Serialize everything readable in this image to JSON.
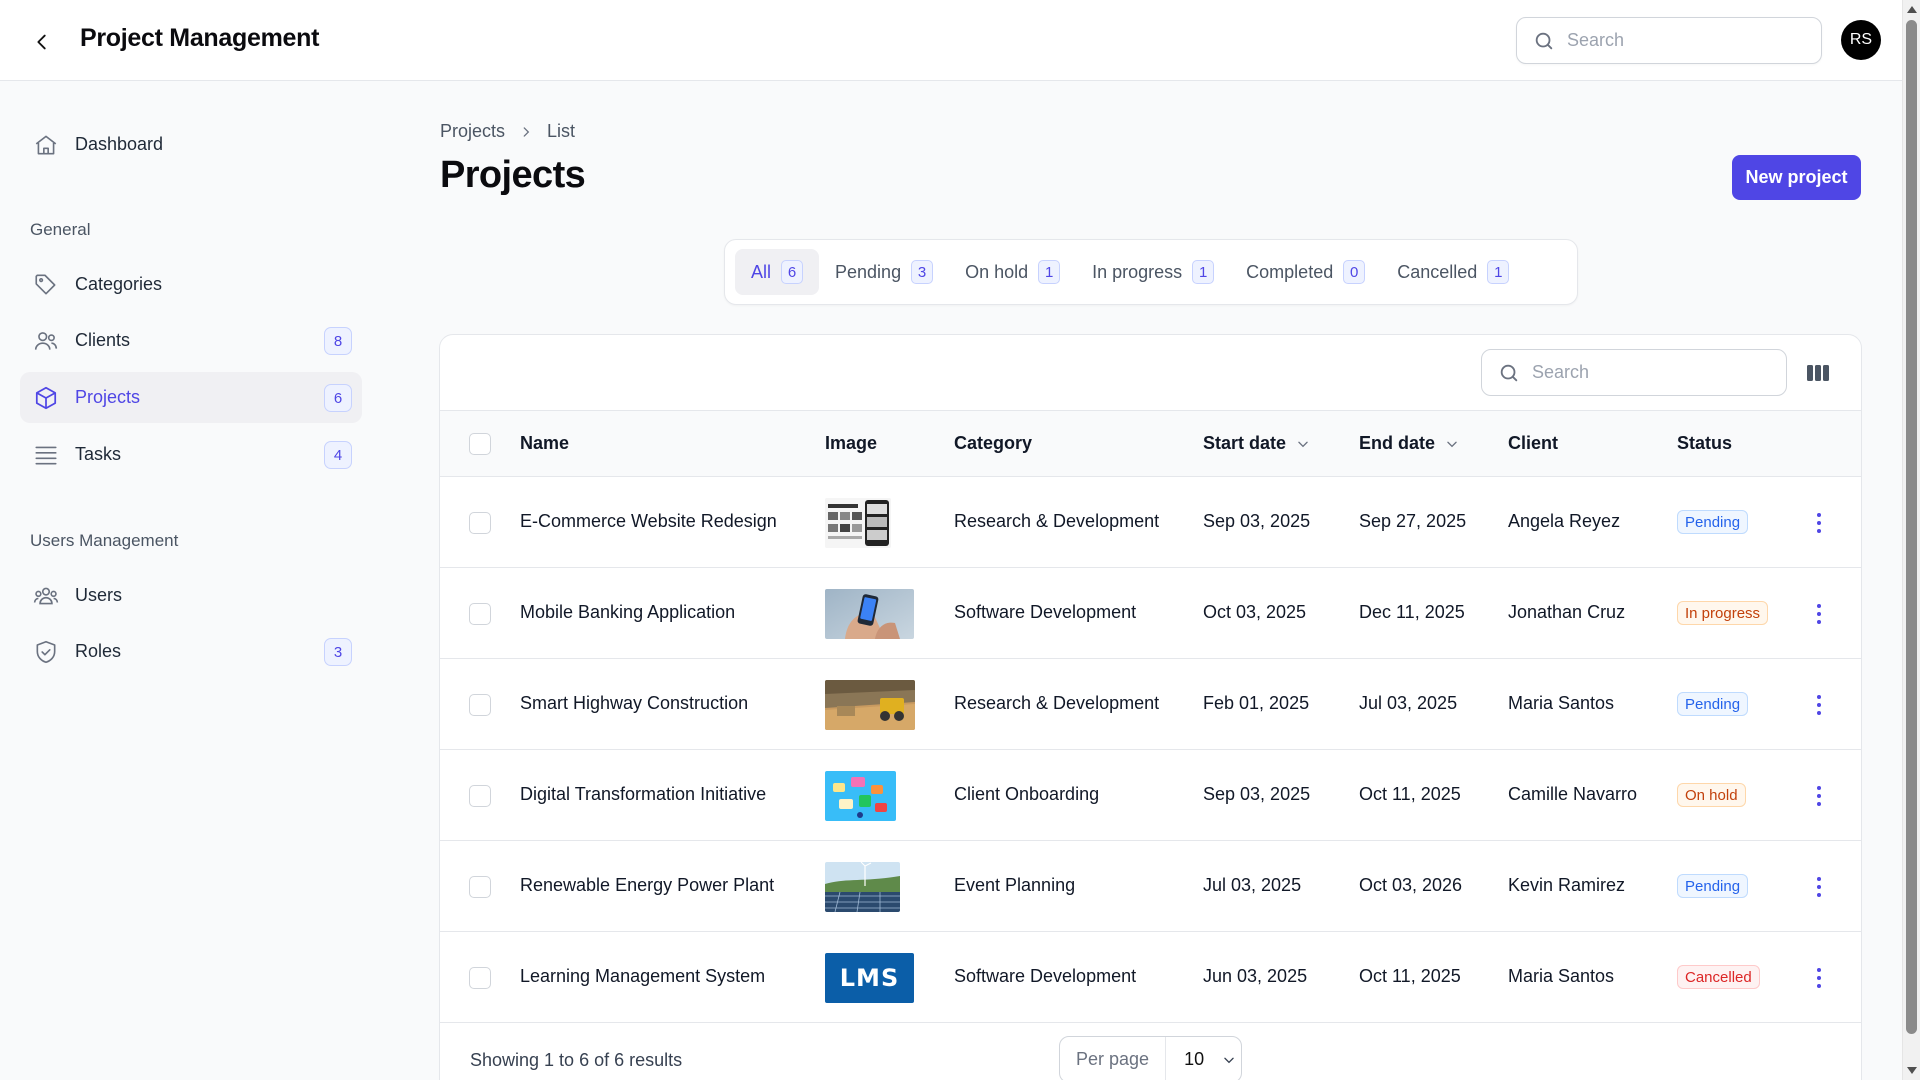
{
  "header": {
    "title": "Project Management",
    "search_placeholder": "Search",
    "avatar_initials": "RS"
  },
  "sidebar": {
    "dashboard": "Dashboard",
    "general_heading": "General",
    "categories": "Categories",
    "clients": {
      "label": "Clients",
      "count": "8"
    },
    "projects": {
      "label": "Projects",
      "count": "6"
    },
    "tasks": {
      "label": "Tasks",
      "count": "4"
    },
    "users_heading": "Users Management",
    "users": "Users",
    "roles": {
      "label": "Roles",
      "count": "3"
    }
  },
  "breadcrumb": [
    "Projects",
    "List"
  ],
  "page_title": "Projects",
  "new_button": "New project",
  "tabs": [
    {
      "label": "All",
      "count": "6"
    },
    {
      "label": "Pending",
      "count": "3"
    },
    {
      "label": "On hold",
      "count": "1"
    },
    {
      "label": "In progress",
      "count": "1"
    },
    {
      "label": "Completed",
      "count": "0"
    },
    {
      "label": "Cancelled",
      "count": "1"
    }
  ],
  "table": {
    "search_placeholder": "Search",
    "columns": {
      "name": "Name",
      "image": "Image",
      "category": "Category",
      "start": "Start date",
      "end": "End date",
      "client": "Client",
      "status": "Status"
    },
    "rows": [
      {
        "name": "E-Commerce Website Redesign",
        "image": "ecommerce-mockup",
        "category": "Research & Development",
        "start": "Sep 03, 2025",
        "end": "Sep 27, 2025",
        "client": "Angela Reyez",
        "status": "Pending",
        "status_key": "pending"
      },
      {
        "name": "Mobile Banking Application",
        "image": "phone-in-hand",
        "category": "Software Development",
        "start": "Oct 03, 2025",
        "end": "Dec 11, 2025",
        "client": "Jonathan Cruz",
        "status": "In progress",
        "status_key": "inprogress"
      },
      {
        "name": "Smart Highway Construction",
        "image": "construction-site",
        "category": "Research & Development",
        "start": "Feb 01, 2025",
        "end": "Jul 03, 2025",
        "client": "Maria Santos",
        "status": "Pending",
        "status_key": "pending"
      },
      {
        "name": "Digital Transformation Initiative",
        "image": "digital-icons",
        "category": "Client Onboarding",
        "start": "Sep 03, 2025",
        "end": "Oct 11, 2025",
        "client": "Camille Navarro",
        "status": "On hold",
        "status_key": "onhold"
      },
      {
        "name": "Renewable Energy Power Plant",
        "image": "solar-wind-farm",
        "category": "Event Planning",
        "start": "Jul 03, 2025",
        "end": "Oct 03, 2026",
        "client": "Kevin Ramirez",
        "status": "Pending",
        "status_key": "pending"
      },
      {
        "name": "Learning Management System",
        "image": "lms-banner",
        "category": "Software Development",
        "start": "Jun 03, 2025",
        "end": "Oct 11, 2025",
        "client": "Maria Santos",
        "status": "Cancelled",
        "status_key": "cancelled"
      }
    ],
    "lms_text": "LMS"
  },
  "footer": {
    "showing": "Showing 1 to 6 of 6 results",
    "per_page_label": "Per page",
    "per_page_value": "10"
  },
  "colors": {
    "accent": "#4f46e5",
    "pending": "#2563eb",
    "in_progress": "#c2410c",
    "on_hold": "#c2410c",
    "cancelled": "#dc2626"
  }
}
